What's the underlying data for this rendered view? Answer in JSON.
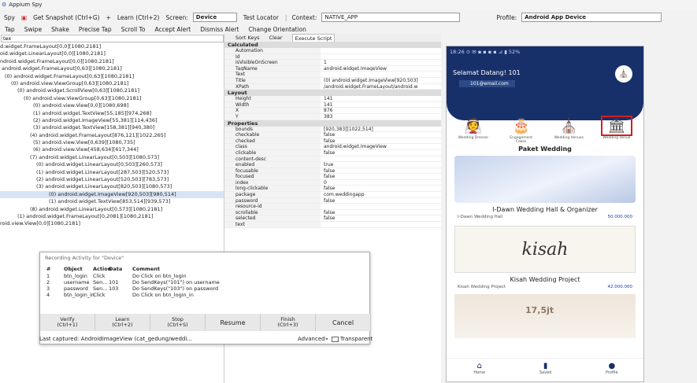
{
  "titlebar": {
    "title": "Appium Spy"
  },
  "toolbar": {
    "spy": "Spy",
    "snapshot": "Get Snapshot (Ctrl+G)",
    "learn": "Learn (Ctrl+2)",
    "screen_label": "Screen:",
    "screen_value": "Device",
    "test_locator": "Test Locator",
    "context_label": "Context:",
    "context_value": "NATIVE_APP",
    "profile_label": "Profile:",
    "profile_value": "Android App Device"
  },
  "toolbar2": {
    "tap": "Tap",
    "swipe": "Swipe",
    "shake": "Shake",
    "precise_tap": "Precise Tap",
    "scroll_to": "Scroll To",
    "accept_alert": "Accept Alert",
    "dismiss_alert": "Dismiss Alert",
    "change_orientation": "Change Orientation"
  },
  "tree": {
    "search_value": "tex",
    "nodes": [
      {
        "text": "d.widget.FrameLayout[0,0][1080,2181]",
        "indent": 0
      },
      {
        "text": "oid.widget.LinearLayout[0,0][1080,2181]",
        "indent": 0
      },
      {
        "text": "ndroid.widget.FrameLayout[0,0][1080,2181]",
        "indent": 0
      },
      {
        "text": "android.widget.FrameLayout[0,63][1080,2181]",
        "indent": 2
      },
      {
        "text": "(0) android.widget.FrameLayout[0,63][1080,2181]",
        "indent": 6
      },
      {
        "text": "(0) android.view.ViewGroup[0,63][1080,2181]",
        "indent": 14
      },
      {
        "text": "(0) android.widget.ScrollView[0,63][1080,2181]",
        "indent": 22
      },
      {
        "text": "(0) android.view.ViewGroup[0,63][1080,2181]",
        "indent": 30
      },
      {
        "text": "(0) android.view.View[0,0][1080,698]",
        "indent": 42
      },
      {
        "text": "(1) android.widget.TextView[55,185][974,268]",
        "indent": 42
      },
      {
        "text": "(2) android.widget.ImageView[55,381][114,436]",
        "indent": 42
      },
      {
        "text": "(3) android.widget.TextView[158,381][940,380]",
        "indent": 42
      },
      {
        "text": "(4) android.widget.FrameLayout[876,121][1022,265]",
        "indent": 38
      },
      {
        "text": "(5) android.view.View[0,639][1080,735]",
        "indent": 42
      },
      {
        "text": "(6) android.view.View[458,634][617,344]",
        "indent": 42
      },
      {
        "text": "(7) android.widget.LinearLayout[0,503][1080,573]",
        "indent": 38
      },
      {
        "text": "(0) android.widget.LinearLayout[0,503][260,573]",
        "indent": 46
      },
      {
        "text": "(1) android.widget.LinearLayout[287,503][520,573]",
        "indent": 46
      },
      {
        "text": "(2) android.widget.LinearLayout[520,503][783,573]",
        "indent": 46
      },
      {
        "text": "(3) android.widget.LinearLayout[820,503][1080,573]",
        "indent": 46
      },
      {
        "text": "(0) android.widget.ImageView[920,503][980,514]",
        "indent": 62,
        "selected": true
      },
      {
        "text": "(1) android.widget.TextView[853,514][939,573]",
        "indent": 62
      },
      {
        "text": "(8) android.widget.LinearLayout[0,573][1080,2181]",
        "indent": 38
      },
      {
        "text": "(1) android.widget.FrameLayout[0,2081][1080,2181]",
        "indent": 22
      },
      {
        "text": "roid.view.View[0,0][1080,2181]",
        "indent": 0
      }
    ]
  },
  "props": {
    "tabs": [
      "Sort Keys",
      "Clear",
      "Execute Script"
    ],
    "active_tab": 2,
    "sections": [
      {
        "title": "Calculated",
        "rows": [
          [
            "Automation",
            ""
          ],
          [
            "Id",
            ""
          ],
          [
            "IsVisibleOnScreen",
            "1"
          ],
          [
            "TagName",
            "android.widget.ImageView"
          ],
          [
            "Text",
            ""
          ],
          [
            "Title",
            "(0) android.widget.ImageView[920,503]"
          ],
          [
            "XPath",
            "/android.widget.FrameLayout/android.w"
          ]
        ]
      },
      {
        "title": "Layout",
        "rows": [
          [
            "Height",
            "141"
          ],
          [
            "Width",
            "141"
          ],
          [
            "X",
            "876"
          ],
          [
            "Y",
            "383"
          ]
        ]
      },
      {
        "title": "Properties",
        "rows": [
          [
            "bounds",
            "[920,383][1022,514]"
          ],
          [
            "checkable",
            "false"
          ],
          [
            "checked",
            "false"
          ],
          [
            "class",
            "android.widget.ImageView"
          ],
          [
            "clickable",
            "false"
          ],
          [
            "content-desc",
            ""
          ],
          [
            "enabled",
            "true"
          ],
          [
            "focusable",
            "false"
          ],
          [
            "focused",
            "false"
          ],
          [
            "index",
            "0"
          ],
          [
            "long-clickable",
            "false"
          ],
          [
            "package",
            "com.weddingapp"
          ],
          [
            "password",
            "false"
          ],
          [
            "resource-id",
            ""
          ],
          [
            "scrollable",
            "false"
          ],
          [
            "selected",
            "false"
          ],
          [
            "text",
            ""
          ]
        ]
      }
    ]
  },
  "recorder": {
    "title": "Recording Activity for \"Device\"",
    "headers": [
      "#",
      "Object",
      "Action",
      "Data",
      "Comment"
    ],
    "rows": [
      [
        "1",
        "btn_login",
        "Click",
        "",
        "Do Click on btn_login"
      ],
      [
        "2",
        "username",
        "Sen...",
        "101",
        "Do SendKeys(\"101\") on username"
      ],
      [
        "3",
        "password",
        "Sen...",
        "103",
        "Do SendKeys(\"103\") on password"
      ],
      [
        "4",
        "btn_login_in",
        "Click",
        "",
        "Do Click on btn_login_in"
      ]
    ],
    "buttons": [
      {
        "label": "Verify",
        "shortcut": "(Ctrl+1)"
      },
      {
        "label": "Learn",
        "shortcut": "(Ctrl+2)"
      },
      {
        "label": "Stop",
        "shortcut": "(Ctrl+S)"
      },
      {
        "label": "Resume",
        "shortcut": ""
      },
      {
        "label": "Finish",
        "shortcut": "(Ctrl+3)"
      },
      {
        "label": "Cancel",
        "shortcut": ""
      }
    ]
  },
  "statusbar": {
    "text": "Last captured: AndroidImageView (cat_gedung/weddi...",
    "advanced": "Advanced»",
    "transparent": "Transparent"
  },
  "phone": {
    "statusbar": "18:26  ⊙ ✉ ▪ ▪ ▪ ▪    ⊿ ▮ 52%",
    "greeting": "Selamat Datang! 101",
    "badge": "101@email.com",
    "categories": [
      {
        "icon": "👰",
        "label": "Wedding Dresser"
      },
      {
        "icon": "🎂",
        "label": "Engagement Cakes"
      },
      {
        "icon": "⛪",
        "label": "Wedding Venues"
      },
      {
        "icon": "🏛",
        "label": "Wedding Venue"
      }
    ],
    "section_title": "Paket Wedding",
    "cards": [
      {
        "name": "I-Dawn Wedding Hall & Organizer",
        "vendor": "I-Dawn Wedding Hall",
        "price": "50.000.000"
      },
      {
        "name": "Kisah Wedding Project",
        "vendor": "Kisah Wedding Project",
        "price": "42.000.000"
      }
    ],
    "card_image_text": "kisah",
    "card3_text": "17,5jt",
    "nav": [
      "Home",
      "Saved",
      "Profile"
    ]
  },
  "colors": {
    "phone_header": "#18306a",
    "accent": "#1e40a0",
    "selection": "#d02020"
  }
}
